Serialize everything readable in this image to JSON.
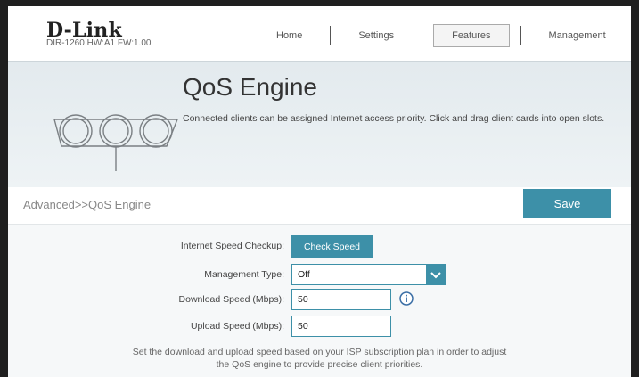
{
  "header": {
    "brand": "D-Link",
    "device_info": "DIR-1260 HW:A1 FW:1.00",
    "nav": [
      "Home",
      "Settings",
      "Features",
      "Management"
    ],
    "active_nav": "Features"
  },
  "banner": {
    "title": "QoS Engine",
    "description": "Connected clients can be assigned Internet access priority. Click and drag client cards into open slots."
  },
  "breadcrumb": "Advanced>>QoS Engine",
  "save_label": "Save",
  "form": {
    "speed_check_label": "Internet Speed Checkup:",
    "speed_check_button": "Check Speed",
    "management_type_label": "Management Type:",
    "management_type_value": "Off",
    "download_label": "Download Speed (Mbps):",
    "download_value": "50",
    "upload_label": "Upload Speed (Mbps):",
    "upload_value": "50",
    "note_line1": "Set the download and upload speed based on your ISP subscription plan in order to adjust",
    "note_line2": "the QoS engine to provide precise client priorities."
  },
  "colors": {
    "accent": "#3d90a8",
    "banner_bg": "#e3eaee"
  },
  "icons": [
    "chevron-down-icon",
    "info-icon",
    "qos-circles-illustration"
  ]
}
